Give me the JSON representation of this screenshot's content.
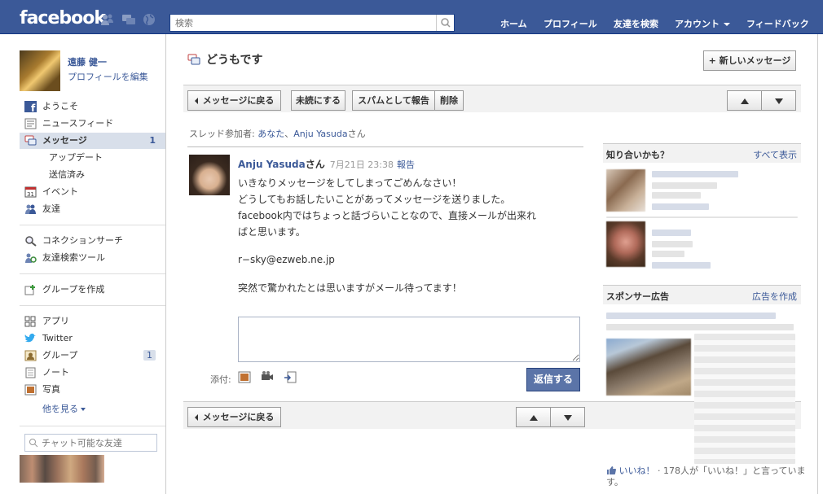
{
  "topbar": {
    "logo": "facebook",
    "search_placeholder": "検索",
    "nav": [
      "ホーム",
      "プロフィール",
      "友達を検索",
      "アカウント",
      "フィードバック"
    ]
  },
  "profile": {
    "name": "遠藤 健一",
    "edit_label": "プロフィールを編集"
  },
  "sidebar": {
    "items": [
      {
        "label": "ようこそ",
        "icon": "facebook-icon"
      },
      {
        "label": "ニュースフィード",
        "icon": "newsfeed-icon"
      },
      {
        "label": "メッセージ",
        "icon": "messages-icon",
        "count": "1"
      },
      {
        "label": "アップデート"
      },
      {
        "label": "送信済み"
      },
      {
        "label": "イベント",
        "icon": "calendar-icon"
      },
      {
        "label": "友達",
        "icon": "friends-icon"
      },
      {
        "label": "コネクションサーチ",
        "icon": "magnifier-icon"
      },
      {
        "label": "友達検索ツール",
        "icon": "friend-finder-icon"
      },
      {
        "label": "グループを作成",
        "icon": "create-group-icon"
      },
      {
        "label": "アプリ",
        "icon": "apps-icon"
      },
      {
        "label": "Twitter",
        "icon": "twitter-icon"
      },
      {
        "label": "グループ",
        "icon": "group-icon",
        "count": "1"
      },
      {
        "label": "ノート",
        "icon": "notes-icon"
      },
      {
        "label": "写真",
        "icon": "photos-icon"
      }
    ],
    "more_label": "他を見る",
    "chat_placeholder": "チャット可能な友達"
  },
  "thread": {
    "title": "どうもです",
    "new_message_label": "+ 新しいメッセージ",
    "back_label": "メッセージに戻る",
    "unread_label": "未読にする",
    "spam_label": "スパムとして報告",
    "delete_label": "削除",
    "participants_prefix": "スレッド参加者: ",
    "participant_you": "あなた",
    "participant_sep": "、",
    "participant_other": "Anju Yasuda",
    "participant_suffix": "さん"
  },
  "message": {
    "sender": "Anju Yasuda",
    "sender_suffix": "さん",
    "time": "7月21日 23:38",
    "report_label": "報告",
    "lines": [
      "いきなりメッセージをしてしまってごめんなさい！",
      "どうしてもお話したいことがあってメッセージを送りました。",
      "facebook内ではちょっと話づらいことなので、直接メールが出来れ",
      "ばと思います。",
      "r−sky@ezweb.ne.jp",
      "突然で驚かれたとは思いますがメール待ってます！"
    ]
  },
  "reply": {
    "attach_label": "添付:",
    "reply_button": "返信する"
  },
  "right": {
    "pymk_title": "知り合いかも？",
    "pymk_link": "すべて表示",
    "ads_title": "スポンサー広告",
    "ads_link": "広告を作成",
    "like_link": "いいね！",
    "like_text": "· 178人が「いいね！」と言っています。"
  },
  "colors": {
    "brand": "#3b5998",
    "toolbar": "#f2f2f2",
    "active_nav": "#d8dfea",
    "reply_button": "#5b74a8"
  }
}
